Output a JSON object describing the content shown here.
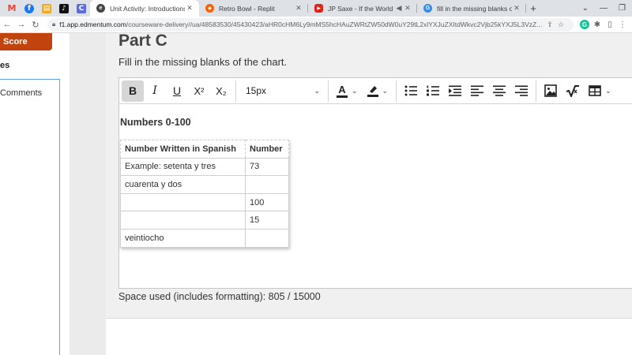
{
  "browser": {
    "pinned_tabs": [
      {
        "icon": "gmail-icon",
        "glyph": "M",
        "color": "#ea4335"
      },
      {
        "icon": "facebook-icon",
        "glyph": "f",
        "color": "#1877f2"
      },
      {
        "icon": "classroom-icon",
        "glyph": "▤",
        "color": "#f4a81d"
      },
      {
        "icon": "tiktok-icon",
        "glyph": "♪",
        "color": "#111111"
      },
      {
        "icon": "canvas-icon",
        "glyph": "C",
        "color": "#5b6cdf"
      }
    ],
    "tabs": [
      {
        "title": "Unit Activity: Introductions",
        "active": true,
        "icon": "edmentum-icon",
        "color": "#444444",
        "glyph": "e"
      },
      {
        "title": "Retro Bowl - Replit",
        "active": false,
        "icon": "replit-icon",
        "color": "#f26207",
        "glyph": "◆"
      },
      {
        "title": "JP Saxe - If the World Was E",
        "active": false,
        "icon": "youtube-icon",
        "color": "#e62117",
        "glyph": "▶"
      },
      {
        "title": "fill in the missing blanks of the",
        "active": false,
        "icon": "brainly-icon",
        "color": "#3b8ad9",
        "glyph": "G"
      }
    ],
    "tab_close_glyph": "✕",
    "new_tab_glyph": "+",
    "address": {
      "host": "f1.app.edmentum.com",
      "path": "/courseware-delivery//ua/48583530/45430423/aHR0cHM6Ly9mMS5hcHAuZWRtZW50dW0uY29tL2xlYXJuZXItdWkvc2Vjb25kYXJ5L3VzZ..."
    }
  },
  "sidebar": {
    "score_label": "Score",
    "section_label": "es",
    "comments_label": "Comments"
  },
  "content": {
    "part_title": "Part C",
    "instructions": "Fill in the missing blanks of the chart.",
    "toolbar": {
      "font_size": "15px",
      "bold": "B",
      "italic": "I",
      "underline": "U",
      "superscript": "X²",
      "subscript": "X₂",
      "text_color": "A"
    },
    "editor": {
      "heading": "Numbers 0-100",
      "table": {
        "headers": [
          "Number Written in Spanish",
          "Number"
        ],
        "rows": [
          [
            "Example: setenta y tres",
            "73"
          ],
          [
            "cuarenta y dos",
            ""
          ],
          [
            "",
            "100"
          ],
          [
            "",
            "15"
          ],
          [
            "veintiocho",
            ""
          ]
        ]
      }
    },
    "space_used": "Space used (includes formatting): 805 / 15000"
  }
}
